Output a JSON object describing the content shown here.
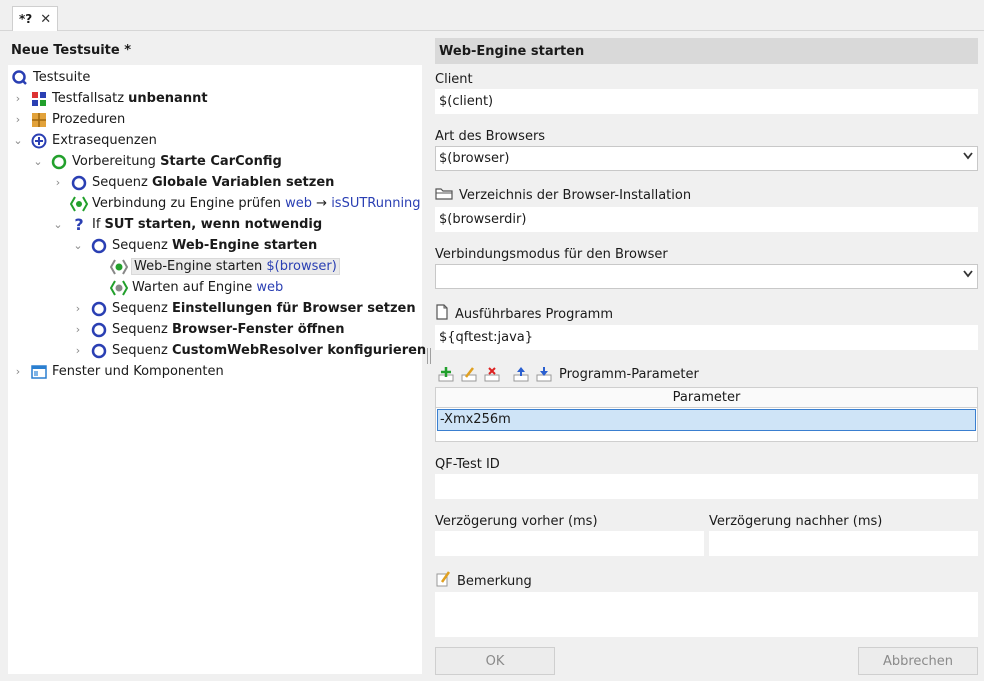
{
  "tab": {
    "title": "*?",
    "close": "✕"
  },
  "suite_title": "Neue Testsuite *",
  "tree": {
    "root": "Testsuite",
    "testfallsatz": {
      "prefix": "Testfallsatz ",
      "name": "unbenannt"
    },
    "prozeduren": "Prozeduren",
    "extrasequenzen": "Extrasequenzen",
    "vorbereitung": {
      "prefix": "Vorbereitung ",
      "name": "Starte CarConfig"
    },
    "seq_globale": {
      "prefix": "Sequenz ",
      "name": "Globale Variablen setzen"
    },
    "verbindung": {
      "prefix": "Verbindung zu Engine prüfen ",
      "engine": "web",
      "arrow": "→",
      "var": "isSUTRunning"
    },
    "if_node": {
      "prefix": "If ",
      "name": "SUT starten, wenn notwendig"
    },
    "seq_webengine": {
      "prefix": "Sequenz ",
      "name": "Web-Engine starten"
    },
    "webengine_starten": {
      "prefix": "Web-Engine starten ",
      "var": "$(browser)"
    },
    "warten": {
      "prefix": "Warten auf Engine ",
      "engine": "web"
    },
    "seq_einstellungen": {
      "prefix": "Sequenz ",
      "name": "Einstellungen für Browser setzen"
    },
    "seq_fenster": {
      "prefix": "Sequenz ",
      "name": "Browser-Fenster öffnen"
    },
    "seq_custom": {
      "prefix": "Sequenz ",
      "name": "CustomWebResolver konfigurieren"
    },
    "fenster": "Fenster und Komponenten"
  },
  "form": {
    "header": "Web-Engine starten",
    "client_label": "Client",
    "client_value": "$(client)",
    "browser_label": "Art des Browsers",
    "browser_value": "$(browser)",
    "browserdir_label": "Verzeichnis der Browser-Installation",
    "browserdir_value": "$(browserdir)",
    "mode_label": "Verbindungsmodus für den Browser",
    "mode_value": "",
    "program_label": "Ausführbares Programm",
    "program_value": "${qftest:java}",
    "params_label": "Programm-Parameter",
    "params_header": "Parameter",
    "params_rows": [
      "-Xmx256m"
    ],
    "id_label": "QF-Test ID",
    "id_value": "",
    "delay_before_label": "Verzögerung vorher (ms)",
    "delay_before_value": "",
    "delay_after_label": "Verzögerung nachher (ms)",
    "delay_after_value": "",
    "remark_label": "Bemerkung",
    "remark_value": "",
    "ok_label": "OK",
    "cancel_label": "Abbrechen"
  },
  "colors": {
    "accent_blue": "#2a3fb3",
    "green": "#22a02c",
    "selection": "#cfe4f7"
  }
}
